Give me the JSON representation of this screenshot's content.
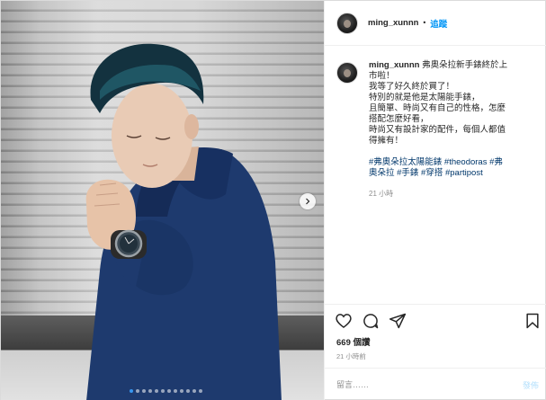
{
  "post": {
    "username": "ming_xunnn",
    "separator": "•",
    "follow_label": "追蹤",
    "caption_lines": [
      "弗奧朵拉新手錶終於上",
      "市啦！",
      "我等了好久終於買了！",
      "特別的就是他是太陽能手錶，",
      "且簡單、時尚又有自己的性格，怎麼",
      "搭配怎麼好看，",
      "時尚又有設計家的配件，每個人都值",
      "得擁有！"
    ],
    "hashtag_lines": [
      "#弗奧朵拉太陽能錶 #theodoras #弗",
      "奧朵拉 #手錶 #穿搭 #partipost"
    ],
    "comment_time": "21 小時",
    "likes": "669 個讚",
    "posted_ago": "21 小時前"
  },
  "comment_box": {
    "placeholder": "留言……",
    "post_label": "發佈"
  },
  "carousel": {
    "dot_count": 12,
    "active_index": 0
  },
  "icons": {
    "like": "heart-icon",
    "comment": "comment-icon",
    "share": "share-icon",
    "save": "bookmark-icon",
    "next": "chevron-right-icon"
  },
  "colors": {
    "follow": "#0095f6",
    "hashtag": "#00376b",
    "muted": "#8e8e8e",
    "post_disabled": "#b2dffc",
    "active_dot": "#3897f0"
  }
}
